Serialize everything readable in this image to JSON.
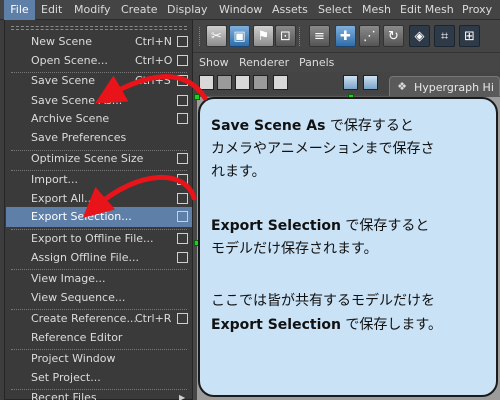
{
  "menubar": {
    "items": [
      "File",
      "Edit",
      "Modify",
      "Create",
      "Display",
      "Window",
      "Assets",
      "Select",
      "Mesh",
      "Edit Mesh",
      "Proxy"
    ]
  },
  "file_menu": {
    "items": [
      {
        "label": "New Scene",
        "shortcut": "Ctrl+N",
        "option_box": true
      },
      {
        "label": "Open Scene...",
        "shortcut": "Ctrl+O",
        "option_box": true
      },
      {
        "label": "Save Scene",
        "shortcut": "Ctrl+S",
        "option_box": true
      },
      {
        "label": "Save Scene As...",
        "shortcut": "",
        "option_box": true
      },
      {
        "label": "Archive Scene",
        "shortcut": "",
        "option_box": true
      },
      {
        "label": "Save Preferences",
        "shortcut": "",
        "option_box": false
      },
      {
        "label": "Optimize Scene Size",
        "shortcut": "",
        "option_box": true
      },
      {
        "label": "Import...",
        "shortcut": "",
        "option_box": true
      },
      {
        "label": "Export All...",
        "shortcut": "",
        "option_box": true
      },
      {
        "label": "Export Selection...",
        "shortcut": "",
        "option_box": true,
        "highlighted": true
      },
      {
        "label": "Export to Offline File...",
        "shortcut": "",
        "option_box": true
      },
      {
        "label": "Assign Offline File...",
        "shortcut": "",
        "option_box": true
      },
      {
        "label": "View Image...",
        "shortcut": "",
        "option_box": false
      },
      {
        "label": "View Sequence...",
        "shortcut": "",
        "option_box": false
      },
      {
        "label": "Create Reference...",
        "shortcut": "Ctrl+R",
        "option_box": true
      },
      {
        "label": "Reference Editor",
        "shortcut": "",
        "option_box": false
      },
      {
        "label": "Project Window",
        "shortcut": "",
        "option_box": false
      },
      {
        "label": "Set Project...",
        "shortcut": "",
        "option_box": false
      },
      {
        "label": "Recent Files",
        "shortcut": "",
        "option_box": false,
        "submenu": true
      }
    ]
  },
  "panel_menu": {
    "items": [
      "Show",
      "Renderer",
      "Panels"
    ]
  },
  "hypergraph_tab": {
    "label": "Hypergraph Hi"
  },
  "callout": {
    "line1_bold": "Save Scene As",
    "line1_rest": " で保存すると",
    "line2": "カメラやアニメーションまで保存さ",
    "line3": "れます。",
    "line4_bold": "Export Selection",
    "line4_rest": " で保存すると",
    "line5": "モデルだけ保存されます。",
    "line6": "ここでは皆が共有するモデルだけを",
    "line7_bold": "Export Selection",
    "line7_rest": " で保存します。"
  },
  "colors": {
    "menu_highlight": "#5d7fa8",
    "callout_fill": "#c9e2f6",
    "arrow": "#e8141a",
    "handle": "#1fd11f"
  },
  "icons": {
    "toolbar": [
      "scissor-tool-icon",
      "select-by-hierarchy-icon",
      "select-by-object-icon",
      "select-by-component-icon",
      "lasso-icon",
      "move-tool-icon",
      "curve-tool-icon",
      "rotate-icon",
      "snap-grid-icon",
      "snap-curve-icon",
      "snap-point-icon"
    ],
    "panel_toolbar": [
      "camera-icon",
      "sphere-icon",
      "grid-icon",
      "cube-icon",
      "select-camera-icon"
    ],
    "hypergraph": "hypergraph-icon",
    "option_box": "option-box-icon",
    "submenu": "submenu-arrow-icon"
  }
}
